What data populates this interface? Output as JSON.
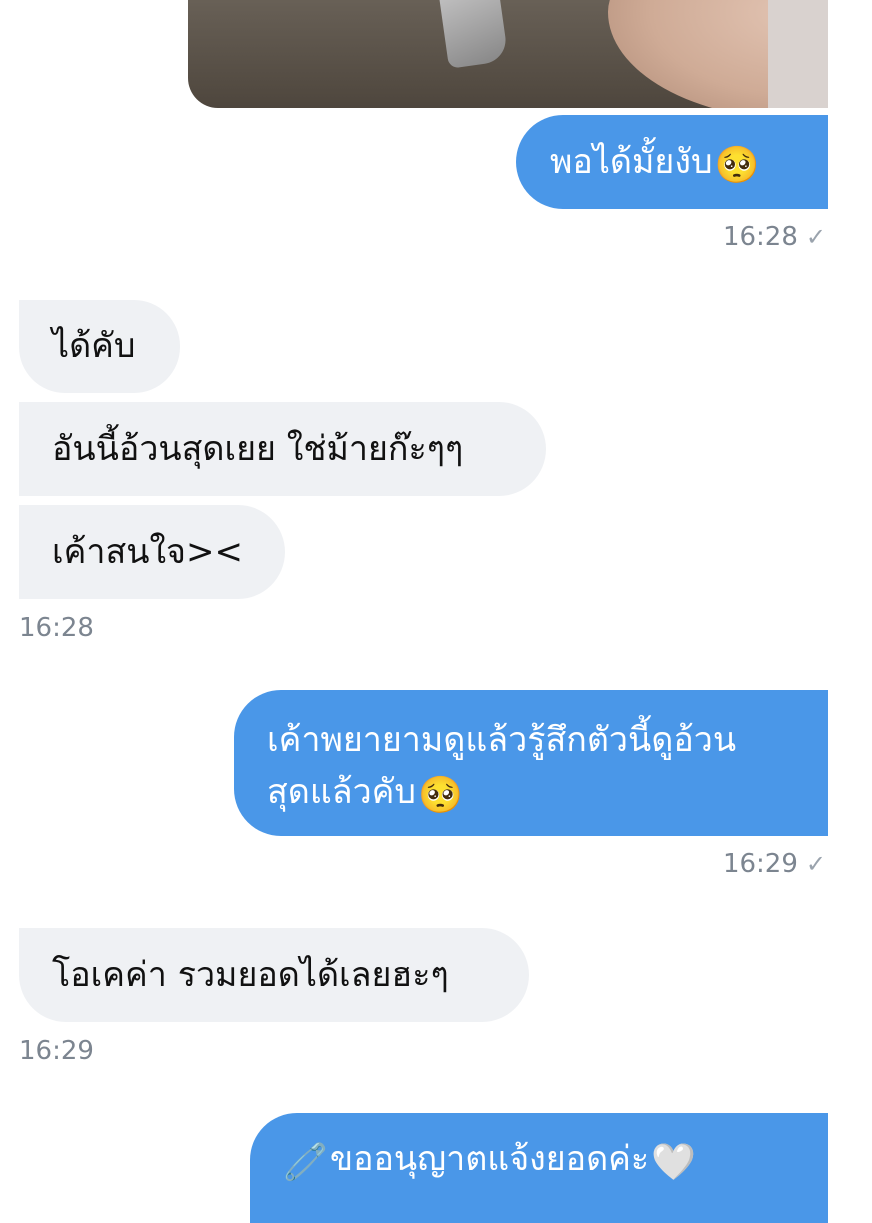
{
  "messages": [
    {
      "text": "พอได้มั้ยงับ",
      "emoji": "🥺"
    },
    {
      "text": "ได้คับ"
    },
    {
      "text": "อันนี้อ้วนสุดเยย ใช่ม้ายก๊ะๆๆ"
    },
    {
      "text": "เค้าสนใจ><"
    },
    {
      "line1": "เค้าพยายามดูแล้วรู้สึกตัวนี้ดูอ้วน",
      "line2": "สุดแล้วคับ",
      "emoji": "🥺"
    },
    {
      "text": "โอเคค่า รวมยอดได้เลยฮะๆ"
    },
    {
      "prefix_emoji": "🧷",
      "text": "ขออนุญาตแจ้งยอดค่ะ",
      "emoji": "🤍"
    }
  ],
  "timestamps": {
    "t1": "16:28",
    "t2": "16:28",
    "t3": "16:29",
    "t4": "16:29"
  },
  "read_check": "✓",
  "colors": {
    "outgoing_bubble": "#4a97e8",
    "incoming_bubble": "#eff1f4",
    "timestamp": "#7c8590"
  }
}
